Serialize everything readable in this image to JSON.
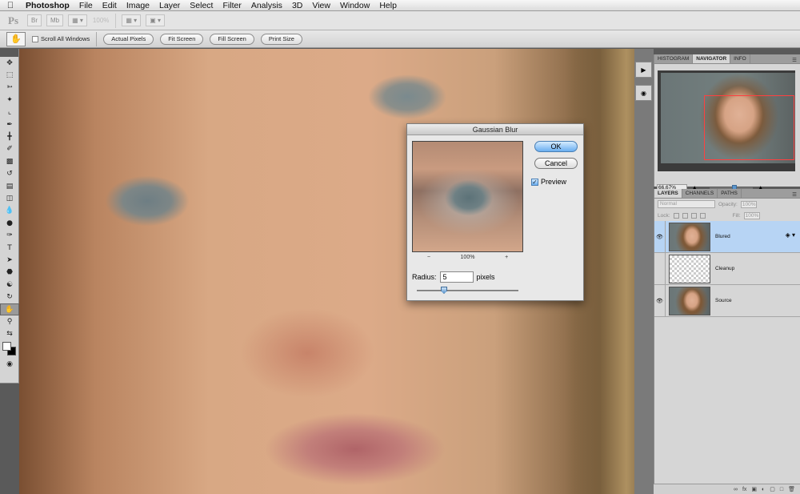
{
  "menubar": {
    "app": "Photoshop",
    "items": [
      "File",
      "Edit",
      "Image",
      "Layer",
      "Select",
      "Filter",
      "Analysis",
      "3D",
      "View",
      "Window",
      "Help"
    ]
  },
  "appbar": {
    "logo": "Ps",
    "zoom": "100%",
    "mb_label": "Mb"
  },
  "options": {
    "scroll_all_windows": "Scroll All Windows",
    "actual_pixels": "Actual Pixels",
    "fit_screen": "Fit Screen",
    "fill_screen": "Fill Screen",
    "print_size": "Print Size"
  },
  "dialog": {
    "title": "Gaussian Blur",
    "ok": "OK",
    "cancel": "Cancel",
    "preview_label": "Preview",
    "preview_checked": true,
    "zoom_minus": "−",
    "zoom_level": "100%",
    "zoom_plus": "+",
    "radius_label": "Radius:",
    "radius_value": "5",
    "radius_unit": "pixels"
  },
  "navigator": {
    "tabs": [
      "HISTOGRAM",
      "NAVIGATOR",
      "INFO"
    ],
    "active_tab": "NAVIGATOR",
    "zoom_value": "66,67%",
    "view_box_color": "#ff4040"
  },
  "layers": {
    "tabs": [
      "LAYERS",
      "CHANNELS",
      "PATHS"
    ],
    "active_tab": "LAYERS",
    "blend_mode": "Normal",
    "opacity_label": "Opacity:",
    "opacity_value": "100%",
    "lock_label": "Lock:",
    "fill_label": "Fill:",
    "fill_value": "100%",
    "items": [
      {
        "name": "Blured",
        "visible": true,
        "selected": true
      },
      {
        "name": "Cleanup",
        "visible": false,
        "selected": false
      },
      {
        "name": "Source",
        "visible": true,
        "selected": false
      }
    ]
  },
  "colors": {
    "selection_blue": "#b7d4f4",
    "ok_button": "#6aaef0"
  }
}
